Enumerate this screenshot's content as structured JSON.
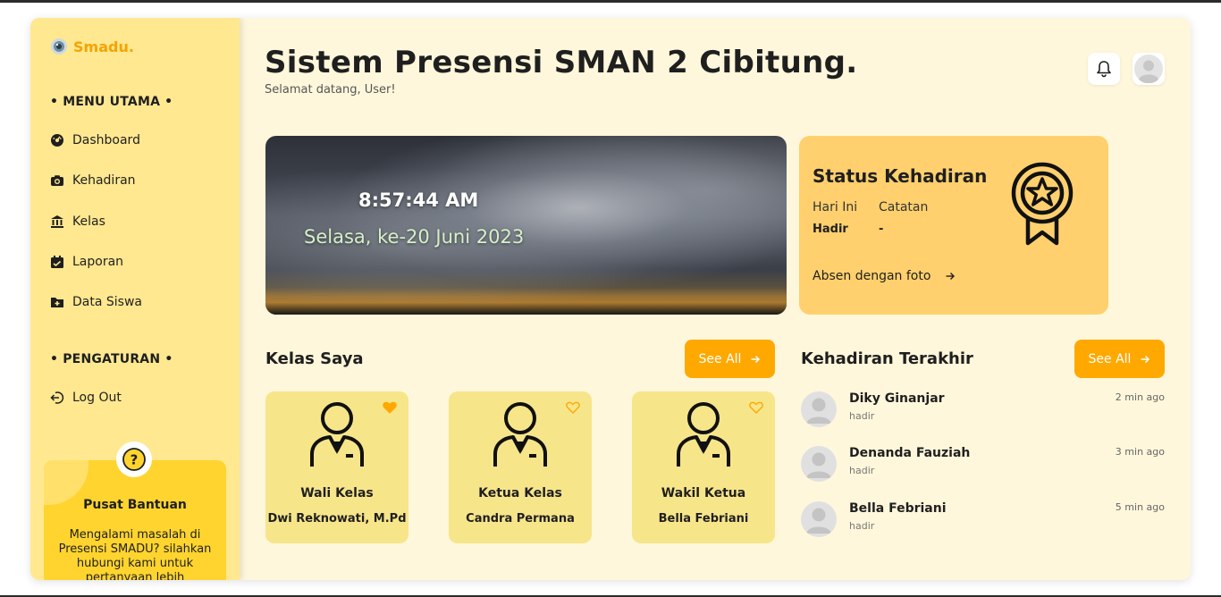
{
  "sidebar": {
    "brand": "Smadu.",
    "menu_label": "• MENU UTAMA •",
    "items": [
      {
        "label": "Dashboard"
      },
      {
        "label": "Kehadiran"
      },
      {
        "label": "Kelas"
      },
      {
        "label": "Laporan"
      },
      {
        "label": "Data Siswa"
      }
    ],
    "settings_label": "• PENGATURAN •",
    "logout_label": "Log Out",
    "help": {
      "title": "Pusat Bantuan",
      "text": "Mengalami masalah di Presensi SMADU? silahkan hubungi kami untuk pertanyaan lebih"
    }
  },
  "header": {
    "title": "Sistem Presensi SMAN 2 Cibitung.",
    "subtitle": "Selamat datang, User!"
  },
  "hero": {
    "time": "8:57:44 AM",
    "date": "Selasa, ke-20 Juni 2023"
  },
  "status": {
    "title": "Status Kehadiran",
    "today_label": "Hari Ini",
    "today_value": "Hadir",
    "note_label": "Catatan",
    "note_value": "-",
    "action_label": "Absen dengan foto"
  },
  "classes": {
    "title": "Kelas Saya",
    "see_all": "See All",
    "cards": [
      {
        "role": "Wali Kelas",
        "name": "Dwi Reknowati, M.Pd",
        "favorited": true
      },
      {
        "role": "Ketua Kelas",
        "name": "Candra Permana",
        "favorited": false
      },
      {
        "role": "Wakil Ketua",
        "name": "Bella Febriani",
        "favorited": false
      }
    ]
  },
  "attendance": {
    "title": "Kehadiran Terakhir",
    "see_all": "See All",
    "rows": [
      {
        "name": "Diky Ginanjar",
        "status": "hadir",
        "time": "2 min ago"
      },
      {
        "name": "Denanda Fauziah",
        "status": "hadir",
        "time": "3 min ago"
      },
      {
        "name": "Bella Febriani",
        "status": "hadir",
        "time": "5 min ago"
      }
    ]
  },
  "colors": {
    "accent": "#ffa800",
    "sidebar": "#ffe890",
    "background": "#fff7db",
    "status_card": "#ffd06d",
    "class_card": "#f7e58a"
  },
  "icons": {
    "brand": "eye-logo-icon",
    "nav": [
      "dashboard-icon",
      "camera-icon",
      "bank-icon",
      "report-icon",
      "folder-icon"
    ],
    "logout": "logout-icon",
    "help": "question-icon",
    "bell": "bell-icon",
    "avatar": "user-avatar-icon",
    "medal": "medal-icon"
  }
}
